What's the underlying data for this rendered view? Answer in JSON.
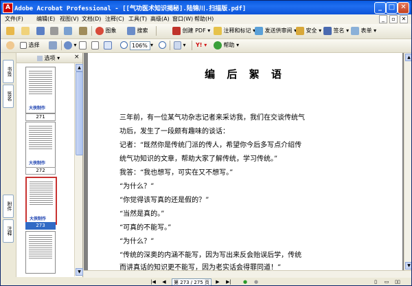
{
  "window": {
    "title": "Adobe Acrobat Professional - [[气功医术知识揭秘].陆锦川.扫描版.pdf]",
    "app_icon": "acrobat-icon",
    "controls": [
      "_",
      "□",
      "✕"
    ]
  },
  "menubar": {
    "items": [
      "文件(F)",
      "编辑(E)",
      "视图(V)",
      "文档(D)",
      "注释(C)",
      "工具(T)",
      "高级(A)",
      "窗口(W)",
      "帮助(H)"
    ],
    "doc_controls": [
      "_",
      "▫",
      "✕"
    ]
  },
  "toolbar1": {
    "buttons": [
      {
        "icon": "open-folder-icon",
        "label": ""
      },
      {
        "icon": "create-icon",
        "label": ""
      },
      {
        "icon": "save-icon",
        "label": ""
      },
      {
        "icon": "print-icon",
        "label": ""
      },
      {
        "icon": "email-icon",
        "label": ""
      },
      {
        "icon": "attach-icon",
        "label": ""
      },
      {
        "icon": "picture-icon",
        "label": "图象"
      },
      {
        "icon": "search-icon",
        "label": "搜索"
      },
      {
        "icon": "create-pdf-icon",
        "label": "创建 PDF"
      },
      {
        "icon": "comment-markup-icon",
        "label": "注释和标记"
      },
      {
        "icon": "send-review-icon",
        "label": "发送供审阅"
      },
      {
        "icon": "lock-icon",
        "label": "安全"
      },
      {
        "icon": "sign-icon",
        "label": "签名"
      },
      {
        "icon": "form-icon",
        "label": "表单"
      }
    ]
  },
  "toolbar2": {
    "hand_label": "",
    "select_label": "选择",
    "zoom_value": "106%",
    "help_label": "帮助"
  },
  "side_tabs": [
    "书签",
    "签名",
    "附件",
    "注释"
  ],
  "thumb_pane": {
    "options_label": "选项",
    "brand_text": "大侠制作",
    "pages": [
      {
        "label": "271",
        "selected": false
      },
      {
        "label": "272",
        "selected": false
      },
      {
        "label": "273",
        "selected": true
      },
      {
        "label": "",
        "selected": false
      }
    ]
  },
  "document": {
    "title": "编 后 絮 语",
    "lines": [
      "    三年前，有一位某气功杂志记者来采访我，我们在交谈传统气",
      "功后，发生了一段颇有趣味的谈话：",
      "    记者：“既然你是传统门派的传人，希望你今后多写点介绍传",
      "统气功知识的文章，帮助大家了解传统，学习传统。”",
      "    我答：“我也想写，可实在又不想写。”",
      "    “为什么？”",
      "    “你觉得该写真的还是假的？”",
      "    “当然是真的。”",
      "    “可真的不能写。”",
      "    “为什么？”",
      "    “传统的深奥的内涵不能写，因为写出来反会贻误后学，传统",
      "而讲真话的知识更不能写，因为老实话会得罪同道！”"
    ]
  },
  "statusbar": {
    "page_display": "第 273 / 275 页"
  }
}
